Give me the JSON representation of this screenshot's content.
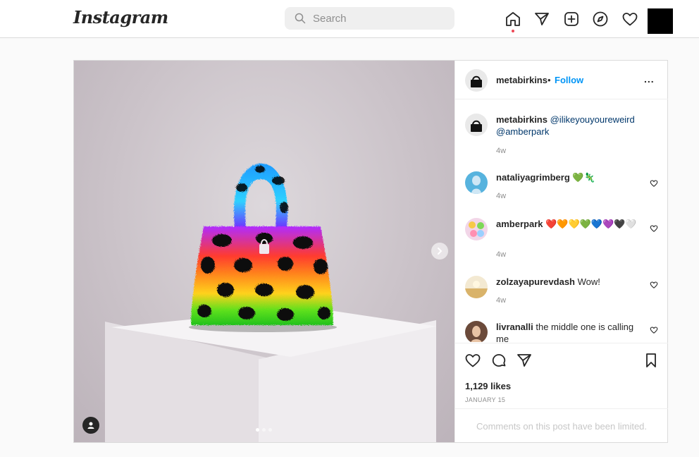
{
  "brand": {
    "logo_text": "Instagram"
  },
  "search": {
    "placeholder": "Search"
  },
  "nav": {
    "icons": [
      "home-icon",
      "direct-icon",
      "new-post-icon",
      "explore-icon",
      "activity-icon",
      "profile-avatar"
    ]
  },
  "post": {
    "author": "metabirkins",
    "separator": "•",
    "follow_label": "Follow",
    "more_label": "...",
    "caption": {
      "user": "metabirkins",
      "mention1": "@ilikeyouyoureweird",
      "mention2": "@amberpark",
      "time": "4w"
    },
    "comments": [
      {
        "user": "nataliyagrimberg",
        "text": "💚🦎",
        "time": "4w"
      },
      {
        "user": "amberpark",
        "text": "❤️🧡💛💚💙💜🖤🤍",
        "time": "4w"
      },
      {
        "user": "zolzayapurevdash",
        "text": "Wow!",
        "time": "4w"
      },
      {
        "user": "livranalli",
        "text": "the middle one is calling me",
        "time": ""
      }
    ],
    "likes": "1,129 likes",
    "date": "JANUARY 15",
    "comments_limited": "Comments on this post have been limited.",
    "carousel": {
      "count": 3,
      "active": 0
    }
  },
  "colors": {
    "link": "#0095f6",
    "mention": "#00376b",
    "muted": "#8e8e8e",
    "border": "#dbdbdb"
  }
}
